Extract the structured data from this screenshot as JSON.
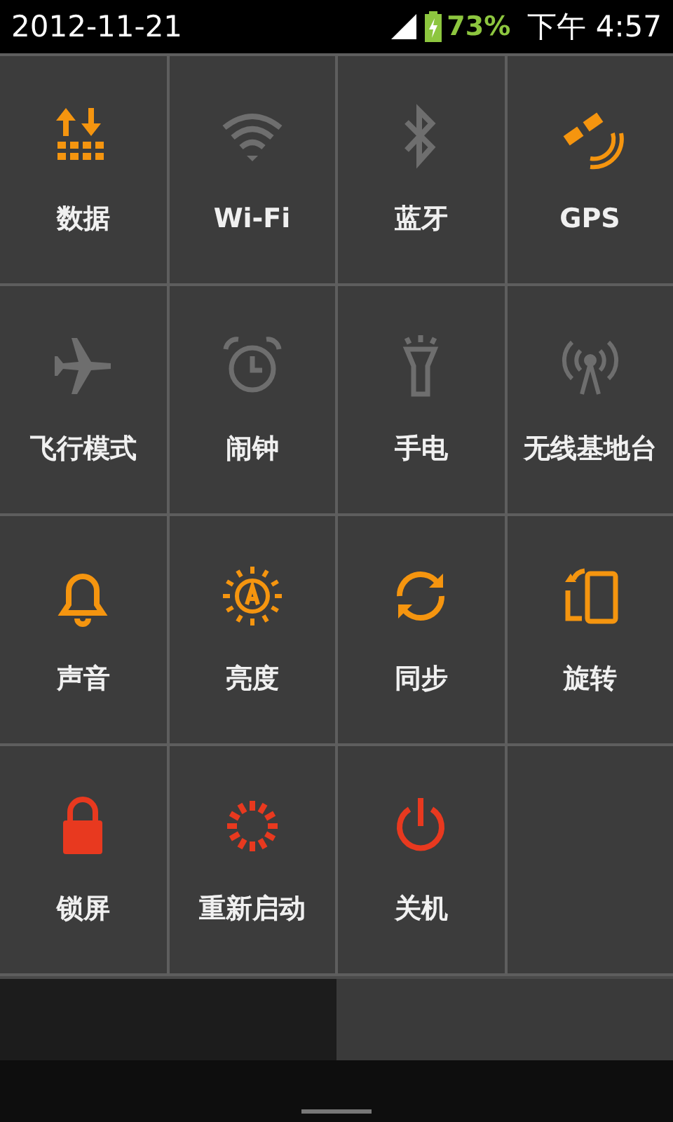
{
  "status_bar": {
    "date": "2012-11-21",
    "battery": "73%",
    "time": "下午 4:57"
  },
  "tiles": [
    {
      "kind": "data",
      "label": "数据",
      "on": true,
      "color": "#f5950f"
    },
    {
      "kind": "wifi",
      "label": "Wi-Fi",
      "on": false
    },
    {
      "kind": "bluetooth",
      "label": "蓝牙",
      "on": false
    },
    {
      "kind": "gps",
      "label": "GPS",
      "on": true,
      "color": "#f5950f"
    },
    {
      "kind": "airplane",
      "label": "飞行模式",
      "on": false
    },
    {
      "kind": "alarm",
      "label": "闹钟",
      "on": false
    },
    {
      "kind": "flashlight",
      "label": "手电",
      "on": false
    },
    {
      "kind": "hotspot",
      "label": "无线基地台",
      "on": false
    },
    {
      "kind": "bell",
      "label": "声音",
      "on": true,
      "color": "#f5950f"
    },
    {
      "kind": "brightness",
      "label": "亮度",
      "on": true,
      "color": "#f5950f"
    },
    {
      "kind": "sync",
      "label": "同步",
      "on": true,
      "color": "#f5950f"
    },
    {
      "kind": "rotate",
      "label": "旋转",
      "on": true,
      "color": "#f5950f"
    },
    {
      "kind": "lock",
      "label": "锁屏",
      "on": true,
      "color": "#e8391f"
    },
    {
      "kind": "reboot",
      "label": "重新启动",
      "on": true,
      "color": "#e8391f"
    },
    {
      "kind": "power",
      "label": "关机",
      "on": true,
      "color": "#e8391f"
    }
  ]
}
